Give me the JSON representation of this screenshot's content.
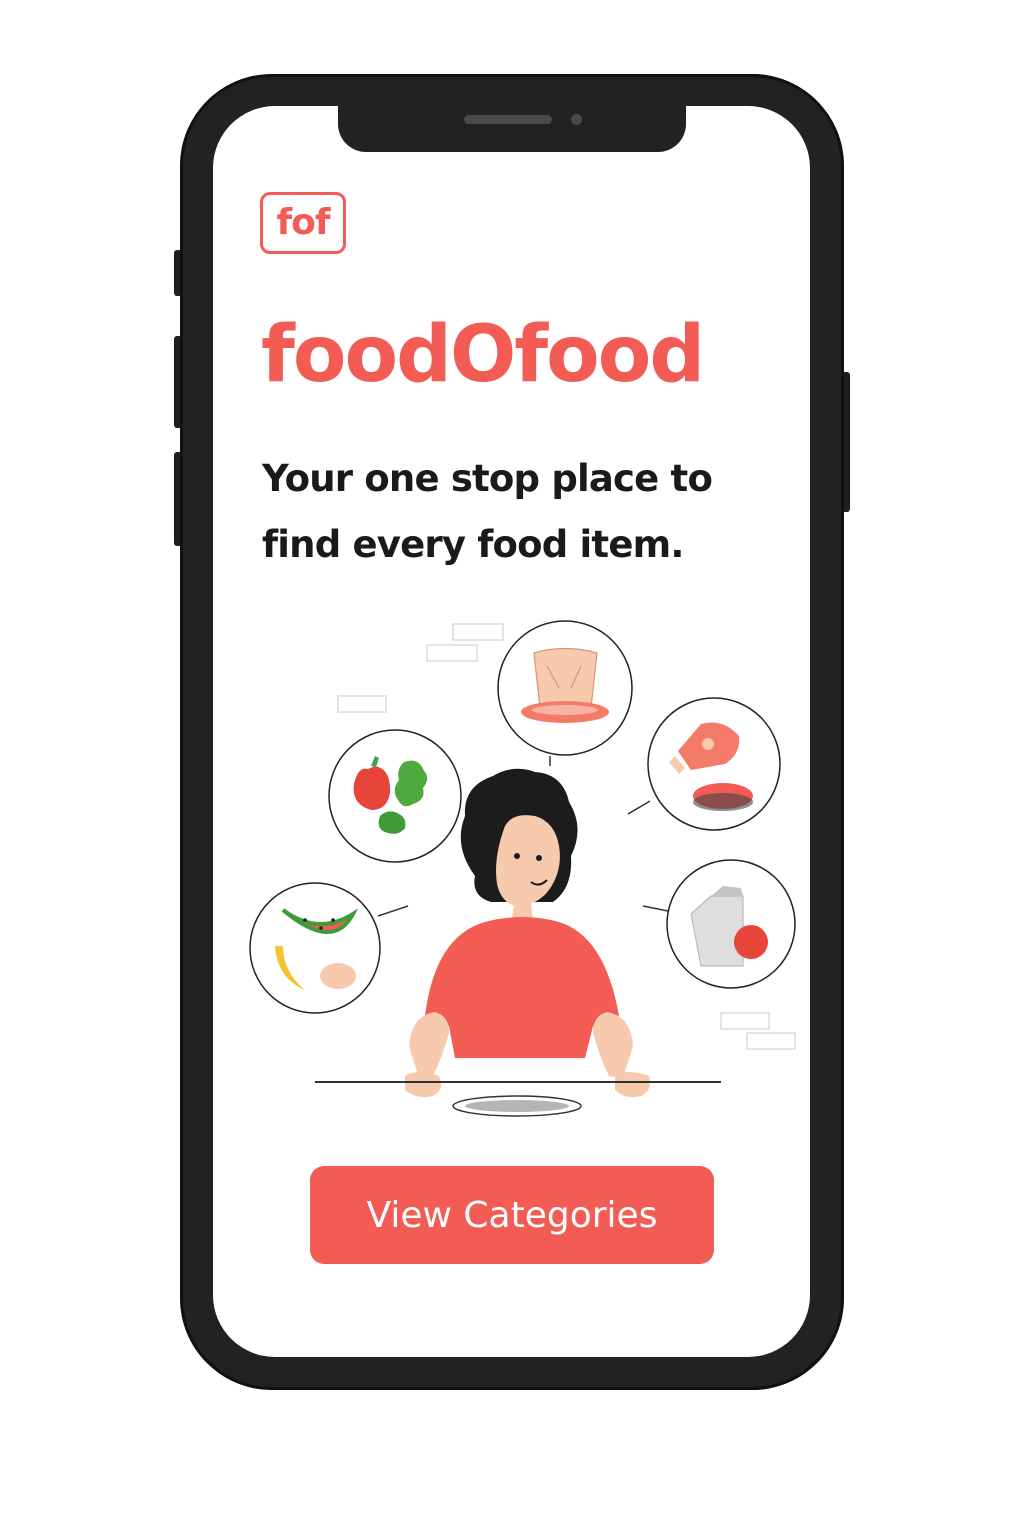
{
  "app": {
    "logo_text": "fof",
    "title": "foodOfood",
    "tagline_line1": "Your one stop place to",
    "tagline_line2": "find every food item."
  },
  "cta": {
    "label": "View Categories"
  },
  "colors": {
    "accent": "#f25c54",
    "text_dark": "#1a1a1a",
    "phone_frame": "#222222",
    "background": "#ffffff"
  },
  "illustration": {
    "subject": "person-seated-at-table-with-empty-plate",
    "food_bubbles": [
      "vegetables-icon",
      "bread-icon",
      "meat-icon",
      "dairy-icon",
      "fruits-icon"
    ]
  }
}
